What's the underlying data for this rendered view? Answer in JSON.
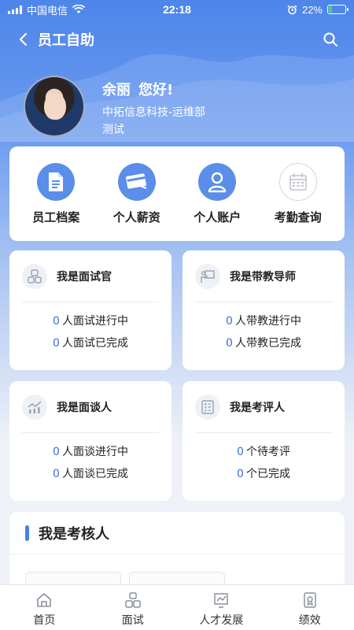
{
  "status": {
    "carrier": "中国电信",
    "time": "22:18",
    "battery": "22%",
    "battery_level": 0.22
  },
  "nav": {
    "title": "员工自助"
  },
  "profile": {
    "name": "余丽",
    "greeting": "您好!",
    "dept": "中拓信息科技-运维部",
    "role": "测试"
  },
  "quick": [
    {
      "label": "员工档案",
      "icon": "document-icon"
    },
    {
      "label": "个人薪资",
      "icon": "salary-card-icon"
    },
    {
      "label": "个人账户",
      "icon": "account-icon"
    },
    {
      "label": "考勤查询",
      "icon": "calendar-icon"
    }
  ],
  "cards": {
    "interviewer": {
      "title": "我是面试官",
      "l1_num": "0",
      "l1": "人面试进行中",
      "l2_num": "0",
      "l2": "人面试已完成"
    },
    "mentor": {
      "title": "我是带教导师",
      "l1_num": "0",
      "l1": "人带教进行中",
      "l2_num": "0",
      "l2": "人带教已完成"
    },
    "talker": {
      "title": "我是面谈人",
      "l1_num": "0",
      "l1": "人面谈进行中",
      "l2_num": "0",
      "l2": "人面谈已完成"
    },
    "reviewer": {
      "title": "我是考评人",
      "l1_num": "0",
      "l1": "个待考评",
      "l2_num": "0",
      "l2": "个已完成"
    }
  },
  "assess": {
    "title": "我是考核人"
  },
  "tabs": [
    {
      "label": "首页",
      "icon": "home-icon"
    },
    {
      "label": "面试",
      "icon": "interview-icon"
    },
    {
      "label": "人才发展",
      "icon": "talent-icon"
    },
    {
      "label": "绩效",
      "icon": "performance-icon"
    }
  ],
  "colors": {
    "primary": "#4e85ea",
    "accent_number": "#3b6fd8",
    "battery_green": "#4cd964"
  }
}
